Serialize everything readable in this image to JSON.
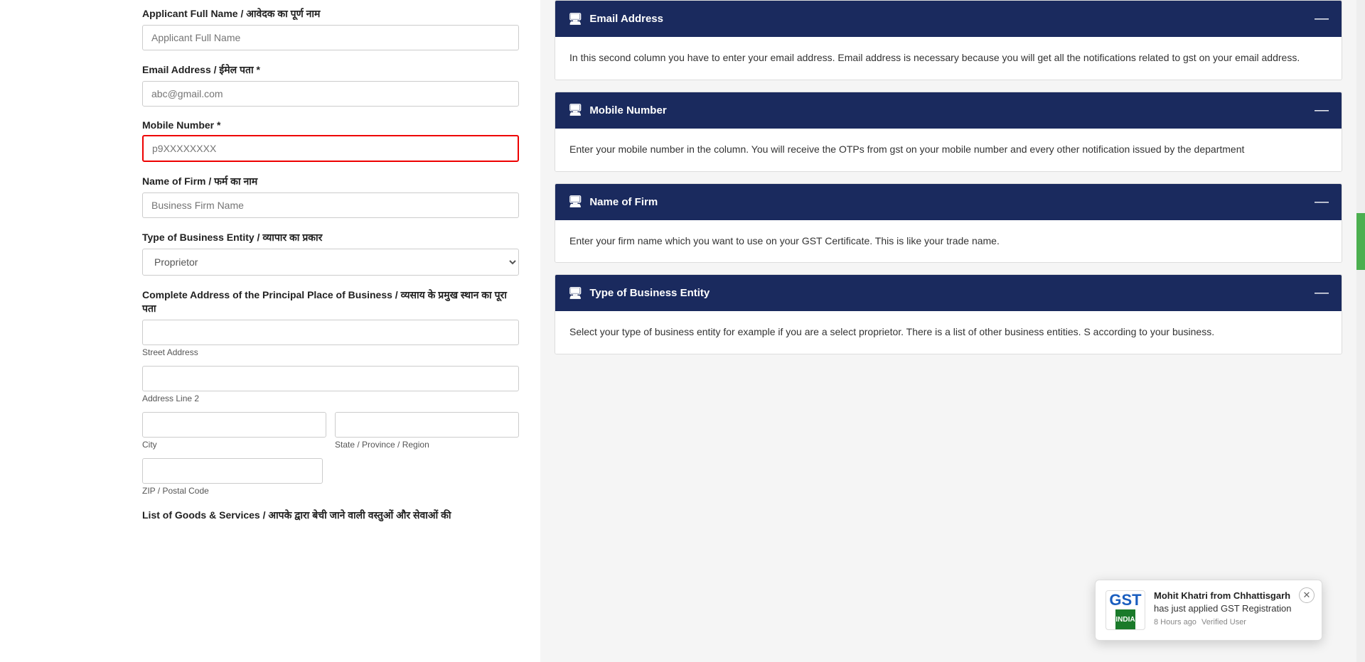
{
  "form": {
    "applicant_full_name_label": "Applicant Full Name / आवेदक का पूर्ण नाम",
    "applicant_full_name_placeholder": "Applicant Full Name",
    "email_label": "Email Address / ईमेल पता *",
    "email_placeholder": "abc@gmail.com",
    "mobile_label": "Mobile Number *",
    "mobile_placeholder": "p9XXXXXXXX",
    "firm_name_label": "Name of Firm / फर्म का नाम",
    "firm_name_placeholder": "Business Firm Name",
    "business_entity_label": "Type of Business Entity / व्यापार का प्रकार",
    "business_entity_value": "Proprietor",
    "address_label": "Complete Address of the Principal Place of Business / व्यसाय के प्रमुख स्थान का पूरा पता",
    "street_address_placeholder": "",
    "street_address_label": "Street Address",
    "address_line2_placeholder": "",
    "address_line2_label": "Address Line 2",
    "city_placeholder": "",
    "city_label": "City",
    "state_placeholder": "",
    "state_label": "State / Province / Region",
    "zip_placeholder": "",
    "zip_label": "ZIP / Postal Code",
    "goods_services_label": "List of Goods & Services / आपके द्वारा बेची जाने वाली वस्तुओं और सेवाओं की"
  },
  "info_cards": [
    {
      "id": "email-address",
      "title": "Email Address",
      "icon": "🖥",
      "description": "In this second column you have to enter your email address. Email address is necessary because you will get all the notifications related to gst on your email address."
    },
    {
      "id": "mobile-number",
      "title": "Mobile Number",
      "icon": "🖥",
      "description": "Enter your mobile number in the column. You will receive the OTPs from gst on your mobile number and every other notification issued by the department"
    },
    {
      "id": "name-of-firm",
      "title": "Name of Firm",
      "icon": "🖥",
      "description": "Enter your firm name which you want to use on your GST Certificate. This is like your trade name."
    },
    {
      "id": "type-of-business",
      "title": "Type of Business Entity",
      "icon": "🖥",
      "description": "Select your type of business entity for example if you are a select proprietor. There is a list of other business entities. S according to your business."
    }
  ],
  "notification": {
    "name": "Mohit Khatri from Chhattisgarh",
    "message": "has just applied GST Registration",
    "time": "8 Hours ago",
    "verified": "Verified User",
    "gst_label": "GST"
  }
}
